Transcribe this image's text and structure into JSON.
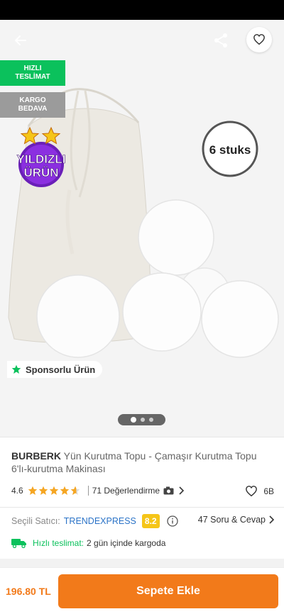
{
  "badges": {
    "fast_delivery": [
      "HIZLI",
      "TESLİMAT"
    ],
    "free_cargo": [
      "KARGO",
      "BEDAVA"
    ],
    "starred": [
      "YILDIZLI",
      "ÜRÜN"
    ]
  },
  "image": {
    "overlay_text": "6 stuks"
  },
  "sponsored": "Sponsorlu Ürün",
  "carousel": {
    "count": 3,
    "active": 1
  },
  "product": {
    "brand": "BURBERK",
    "name": "Yün Kurutma Topu - Çamaşır Kurutma Topu 6'lı-kurutma Makinası",
    "rating": "4.6",
    "rating_value": 4.6,
    "reviews": "71 Değerlendirme",
    "likes": "6B"
  },
  "seller": {
    "label": "Seçili Satıcı:",
    "name": "TRENDEXPRESS",
    "score": "8.2",
    "qa": "47 Soru & Cevap"
  },
  "delivery": {
    "label": "Hızlı teslimat:",
    "text": "2 gün içinde kargoda"
  },
  "footer": {
    "price": "196.80 TL",
    "button": "Sepete Ekle"
  },
  "colors": {
    "accent": "#f27a1a",
    "green": "#0bc15c",
    "seller_link": "#2b73c7",
    "score": "#f5c518"
  }
}
